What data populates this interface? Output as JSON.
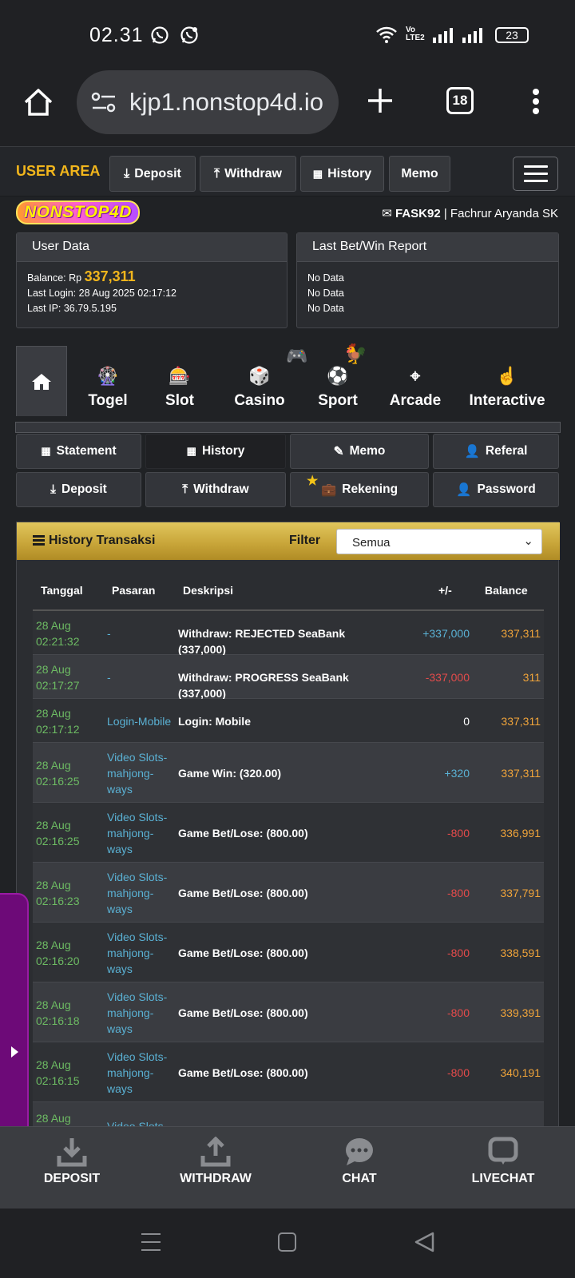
{
  "status_bar": {
    "time": "02.31",
    "network_label": "Vo LTE2",
    "battery": "23"
  },
  "browser": {
    "url": "kjp1.nonstop4d.io",
    "tab_count": "18"
  },
  "top_nav": {
    "user_area": "USER AREA",
    "buttons": [
      "Deposit",
      "Withdraw",
      "History",
      "Memo"
    ]
  },
  "logo_text": "NONSTOP4D",
  "user": {
    "username": "FASK92",
    "separator": " | ",
    "fullname": "Fachrur Aryanda SK"
  },
  "user_data": {
    "title": "User Data",
    "balance_label": "Balance: Rp",
    "balance_value": "337,311",
    "last_login": "Last Login: 28 Aug 2025 02:17:12",
    "last_ip": "Last IP: 36.79.5.195"
  },
  "bet_report": {
    "title": "Last Bet/Win Report",
    "lines": [
      "No Data",
      "No Data",
      "No Data"
    ]
  },
  "categories": [
    "Togel",
    "Slot",
    "Casino",
    "Sport",
    "Arcade",
    "Interactive"
  ],
  "sub_nav": {
    "row1": [
      "Statement",
      "History",
      "Memo",
      "Referal"
    ],
    "row2": [
      "Deposit",
      "Withdraw",
      "Rekening",
      "Password"
    ]
  },
  "history": {
    "title": "History Transaksi",
    "filter_label": "Filter",
    "filter_value": "Semua",
    "columns": [
      "Tanggal",
      "Pasaran",
      "Deskripsi",
      "+/-",
      "Balance"
    ],
    "rows": [
      {
        "date": "28 Aug",
        "time": "02:21:32",
        "pasaran": "-",
        "desc": "Withdraw: REJECTED SeaBank (337,000)",
        "pm": "+337,000",
        "balance": "337,311"
      },
      {
        "date": "28 Aug",
        "time": "02:17:27",
        "pasaran": "-",
        "desc": "Withdraw: PROGRESS SeaBank (337,000)",
        "pm": "-337,000",
        "balance": "311"
      },
      {
        "date": "28 Aug",
        "time": "02:17:12",
        "pasaran": "Login-Mobile",
        "desc": "Login: Mobile",
        "pm": "0",
        "balance": "337,311"
      },
      {
        "date": "28 Aug",
        "time": "02:16:25",
        "pasaran": "Video Slots-mahjong-ways",
        "desc": "Game Win: (320.00)",
        "pm": "+320",
        "balance": "337,311"
      },
      {
        "date": "28 Aug",
        "time": "02:16:25",
        "pasaran": "Video Slots-mahjong-ways",
        "desc": "Game Bet/Lose: (800.00)",
        "pm": "-800",
        "balance": "336,991"
      },
      {
        "date": "28 Aug",
        "time": "02:16:23",
        "pasaran": "Video Slots-mahjong-ways",
        "desc": "Game Bet/Lose: (800.00)",
        "pm": "-800",
        "balance": "337,791"
      },
      {
        "date": "28 Aug",
        "time": "02:16:20",
        "pasaran": "Video Slots-mahjong-ways",
        "desc": "Game Bet/Lose: (800.00)",
        "pm": "-800",
        "balance": "338,591"
      },
      {
        "date": "28 Aug",
        "time": "02:16:18",
        "pasaran": "Video Slots-mahjong-ways",
        "desc": "Game Bet/Lose: (800.00)",
        "pm": "-800",
        "balance": "339,391"
      },
      {
        "date": "28 Aug",
        "time": "02:16:15",
        "pasaran": "Video Slots-mahjong-ways",
        "desc": "Game Bet/Lose: (800.00)",
        "pm": "-800",
        "balance": "340,191"
      },
      {
        "date": "28 Aug",
        "time": "",
        "pasaran": "Video Slots-",
        "desc": "",
        "pm": "",
        "balance": ""
      }
    ]
  },
  "bottom_bar": [
    "DEPOSIT",
    "WITHDRAW",
    "CHAT",
    "LIVECHAT"
  ],
  "colors": {
    "gold": "#f2b61c",
    "green": "#6dbb63",
    "blue": "#5ab1d4",
    "red": "#e34b4b",
    "orange": "#f0a43a",
    "purple": "#6d0a78"
  }
}
